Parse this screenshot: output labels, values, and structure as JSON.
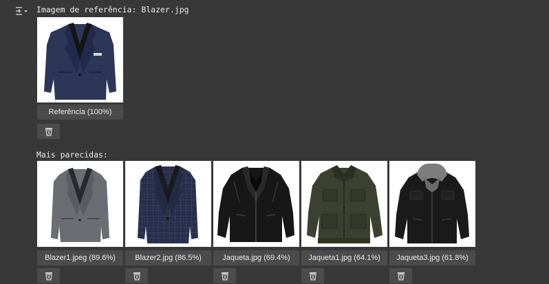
{
  "reference": {
    "header": "Imagem de referência: Blazer.jpg",
    "caption": "Referência (100%)",
    "icon": "navy-blazer-image"
  },
  "similar": {
    "header": "Mais parecidas:",
    "items": [
      {
        "caption": "Blazer1.jpeg (89.6%)",
        "icon": "gray-blazer-image"
      },
      {
        "caption": "Blazer2.jpg (86.5%)",
        "icon": "plaid-blazer-image"
      },
      {
        "caption": "Jaqueta.jpg (69.4%)",
        "icon": "black-leather-jacket-image"
      },
      {
        "caption": "Jaqueta1.jpg (64.1%)",
        "icon": "olive-field-jacket-image"
      },
      {
        "caption": "Jaqueta3.jpg (61.8%)",
        "icon": "hooded-leather-jacket-image"
      }
    ]
  },
  "colors": {
    "background": "#383838",
    "caption_bg": "#4b4b4b",
    "text": "#ececec"
  }
}
